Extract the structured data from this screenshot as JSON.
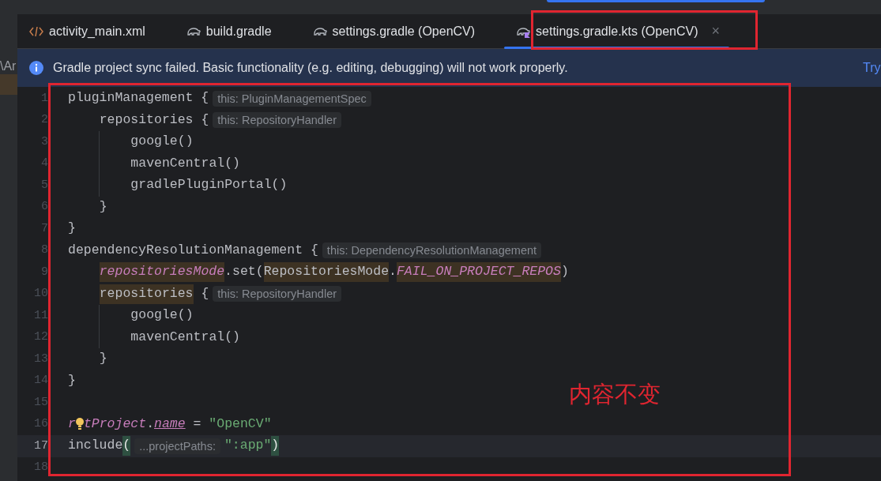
{
  "sidebar": {
    "fragment": "\\Ar",
    "highlight": true
  },
  "tabs": [
    {
      "label": "activity_main.xml",
      "kind": "xml",
      "selected": false
    },
    {
      "label": "build.gradle",
      "kind": "gradle",
      "selected": false
    },
    {
      "label": "settings.gradle (OpenCV)",
      "kind": "gradle",
      "selected": false
    },
    {
      "label": "settings.gradle.kts (OpenCV)",
      "kind": "kts",
      "selected": true,
      "close": "×"
    }
  ],
  "banner": {
    "message": "Gradle project sync failed. Basic functionality (e.g. editing, debugging) will not work properly.",
    "action": "Try"
  },
  "editor": {
    "lines": [
      {
        "number": "1",
        "current": false,
        "tokens": [
          {
            "kind": "code",
            "text": "pluginManagement {"
          },
          {
            "kind": "hint",
            "text": "this: PluginManagementSpec"
          }
        ],
        "children": [
          {
            "number": "2",
            "current": false,
            "tokens": [
              {
                "kind": "code",
                "text": "repositories {"
              },
              {
                "kind": "hint",
                "text": "this: RepositoryHandler"
              }
            ],
            "children": [
              {
                "number": "3",
                "current": false,
                "tokens": [
                  {
                    "kind": "code",
                    "text": "google()"
                  }
                ]
              },
              {
                "number": "4",
                "current": false,
                "tokens": [
                  {
                    "kind": "code",
                    "text": "mavenCentral()"
                  }
                ]
              },
              {
                "number": "5",
                "current": false,
                "tokens": [
                  {
                    "kind": "code",
                    "text": "gradlePluginPortal()"
                  }
                ]
              }
            ]
          },
          {
            "number": "6",
            "current": false,
            "tokens": [
              {
                "kind": "code",
                "text": "}"
              }
            ]
          }
        ]
      },
      {
        "number": "7",
        "current": false,
        "tokens": [
          {
            "kind": "code",
            "text": "}"
          }
        ]
      },
      {
        "number": "8",
        "current": false,
        "tokens": [
          {
            "kind": "code",
            "text": "dependencyResolutionManagement {"
          },
          {
            "kind": "hint",
            "text": "this: DependencyResolutionManagement"
          }
        ],
        "children": [
          {
            "number": "9",
            "current": false,
            "tokens": [
              {
                "kind": "usage_field",
                "text": "repositoriesMode"
              },
              {
                "kind": "code",
                "text": ".set("
              },
              {
                "kind": "usage",
                "text": "RepositoriesMode"
              },
              {
                "kind": "code",
                "text": "."
              },
              {
                "kind": "usage_field",
                "text": "FAIL_ON_PROJECT_REPOS"
              },
              {
                "kind": "code",
                "text": ")"
              }
            ]
          },
          {
            "number": "10",
            "current": false,
            "tokens": [
              {
                "kind": "usage",
                "text": "repositories"
              },
              {
                "kind": "code",
                "text": " {"
              },
              {
                "kind": "hint",
                "text": "this: RepositoryHandler"
              }
            ],
            "children": [
              {
                "number": "11",
                "current": false,
                "tokens": [
                  {
                    "kind": "code",
                    "text": "google()"
                  }
                ]
              },
              {
                "number": "12",
                "current": false,
                "tokens": [
                  {
                    "kind": "code",
                    "text": "mavenCentral()"
                  }
                ]
              }
            ]
          },
          {
            "number": "13",
            "current": false,
            "tokens": [
              {
                "kind": "code",
                "text": "}"
              }
            ]
          }
        ]
      },
      {
        "number": "14",
        "current": false,
        "tokens": [
          {
            "kind": "code",
            "text": "}"
          }
        ]
      },
      {
        "number": "15",
        "current": false
      },
      {
        "number": "16",
        "current": false,
        "tokens": [
          {
            "kind": "field",
            "text": "r"
          },
          {
            "kind": "bulb"
          },
          {
            "kind": "field",
            "text": "tProject"
          },
          {
            "kind": "code",
            "text": "."
          },
          {
            "kind": "field_underlined",
            "text": "name"
          },
          {
            "kind": "code",
            "text": " = "
          },
          {
            "kind": "string",
            "text": "\"OpenCV\""
          }
        ]
      },
      {
        "number": "17",
        "current": true,
        "tokens": [
          {
            "kind": "code",
            "text": "include"
          },
          {
            "kind": "match",
            "text": "("
          },
          {
            "kind": "hint",
            "text": "...projectPaths:"
          },
          {
            "kind": "string",
            "text": "\":app\""
          },
          {
            "kind": "match",
            "text": ")"
          }
        ]
      },
      {
        "number": "18",
        "current": false
      }
    ]
  },
  "annotation": {
    "note": "内容不变"
  }
}
